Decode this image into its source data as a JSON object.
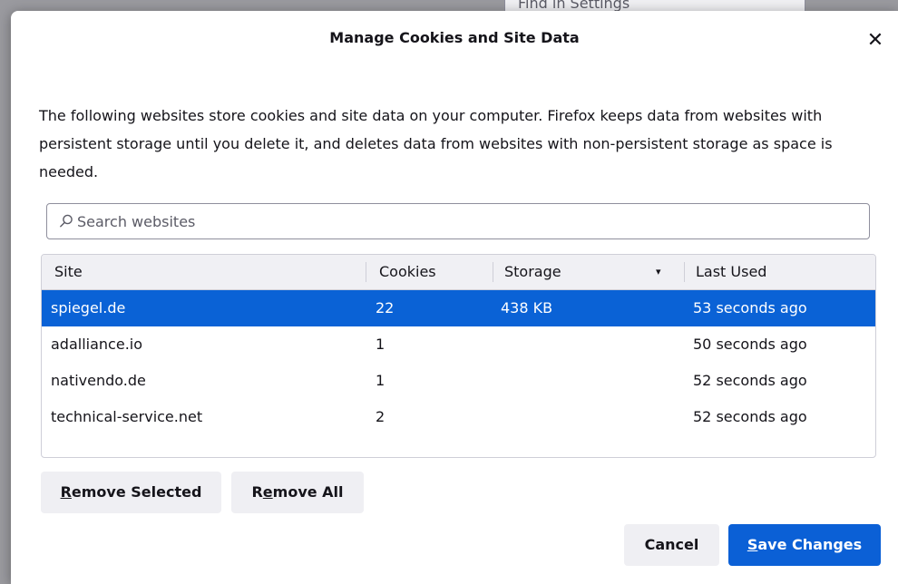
{
  "background": {
    "find_in_settings": "Find in Settings"
  },
  "dialog": {
    "title": "Manage Cookies and Site Data",
    "close_icon": "close-icon",
    "description": "The following websites store cookies and site data on your computer. Firefox keeps data from websites with persistent storage until you delete it, and deletes data from websites with non-persistent storage as space is needed.",
    "search": {
      "placeholder": "Search websites",
      "value": "",
      "icon": "search-icon"
    },
    "table": {
      "columns": {
        "site": "Site",
        "cookies": "Cookies",
        "storage": "Storage",
        "last_used": "Last Used"
      },
      "sort_indicator": "▾",
      "rows": [
        {
          "site": "spiegel.de",
          "cookies": "22",
          "storage": "438 KB",
          "last_used": "53 seconds ago",
          "selected": true
        },
        {
          "site": "adalliance.io",
          "cookies": "1",
          "storage": "",
          "last_used": "50 seconds ago",
          "selected": false
        },
        {
          "site": "nativendo.de",
          "cookies": "1",
          "storage": "",
          "last_used": "52 seconds ago",
          "selected": false
        },
        {
          "site": "technical-service.net",
          "cookies": "2",
          "storage": "",
          "last_used": "52 seconds ago",
          "selected": false
        }
      ]
    },
    "buttons": {
      "remove_selected": {
        "accesskey": "R",
        "rest": "emove Selected"
      },
      "remove_all": {
        "before": "R",
        "accesskey": "e",
        "rest": "move All"
      },
      "cancel": "Cancel",
      "save_changes": {
        "accesskey": "S",
        "rest": "ave Changes"
      }
    },
    "colors": {
      "accent": "#0b60d6",
      "selected_row": "#0a62d6",
      "button_grey": "#efeff3"
    }
  }
}
